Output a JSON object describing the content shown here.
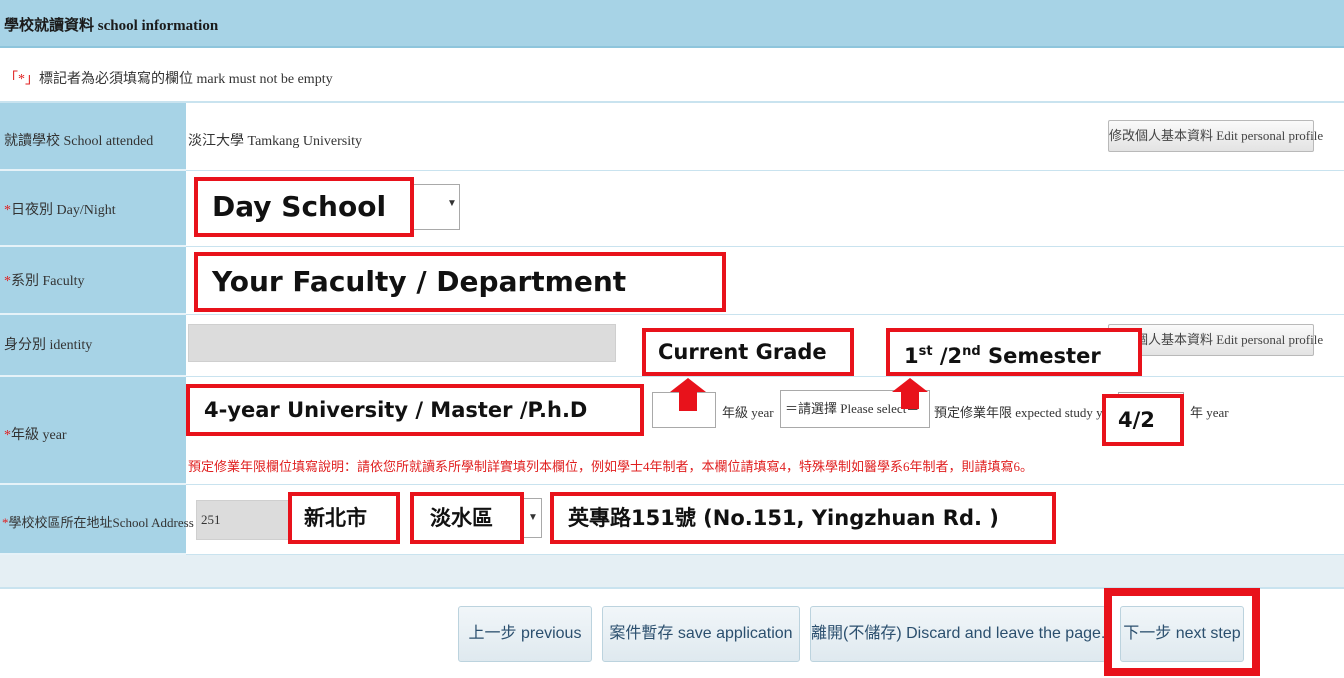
{
  "header": {
    "title": "學校就讀資料 school information"
  },
  "note": {
    "marker": "「*」",
    "text": "標記者為必須填寫的欄位 mark must not be empty"
  },
  "rows": {
    "school": {
      "label": "就讀學校 School attended",
      "value": "淡江大學 Tamkang University",
      "edit_button": "修改個人基本資料 Edit personal profile"
    },
    "daynight": {
      "label": "日夜別 Day/Night",
      "annotation": "Day School"
    },
    "faculty": {
      "label": "系別 Faculty",
      "annotation": "Your Faculty / Department"
    },
    "identity": {
      "label": "身分別 identity",
      "edit_button": "修改個人基本資料 Edit personal profile",
      "annotation_grade": "Current Grade",
      "annotation_semester": "1st /2nd Semester"
    },
    "year": {
      "label": "年級 year",
      "annotation_program": "4-year University / Master /P.h.D",
      "grade_suffix": "年級 year",
      "select_placeholder": "＝請選擇 Please select＝",
      "expected_label": "預定修業年限 expected study year",
      "annotation_years": "4/2",
      "years_suffix": "年 year",
      "hint": "預定修業年限欄位填寫說明：請依您所就讀系所學制詳實填列本欄位，例如學士4年制者，本欄位請填寫4，特殊學制如醫學系6年制者，則請填寫6。"
    },
    "address": {
      "label": "學校校區所在地址School Address",
      "zip": "251",
      "annotation_city": "新北市",
      "annotation_district": "淡水區",
      "annotation_street": "英專路151號 (No.151, Yingzhuan Rd. )"
    }
  },
  "nav": {
    "previous": "上一步 previous",
    "save": "案件暫存 save application",
    "discard": "離開(不儲存) Discard and leave the page.",
    "next": "下一步 next step"
  }
}
